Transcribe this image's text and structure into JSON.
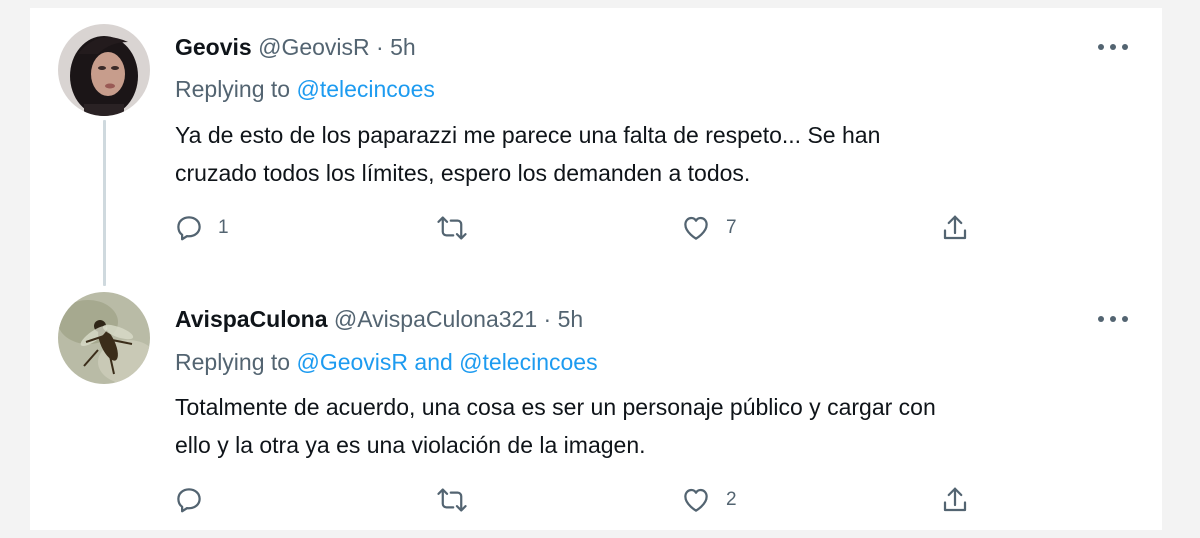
{
  "colors": {
    "link": "#1d9bf0",
    "secondary": "#536471",
    "text": "#0f1419",
    "thread_line": "#cfd9de"
  },
  "tweets": [
    {
      "avatar": "woman-portrait-avatar",
      "name": "Geovis",
      "handle": "@GeovisR",
      "separator": "·",
      "time": "5h",
      "replying_prefix": "Replying to",
      "replying_to": "@telecincoes",
      "text_line1": "Ya de esto de los paparazzi me parece una falta de respeto... Se han",
      "text_line2": "cruzado todos los límites, espero los demanden a todos.",
      "reply_count": "1",
      "retweet_count": "",
      "like_count": "7"
    },
    {
      "avatar": "wasp-avatar",
      "name": "AvispaCulona",
      "handle": "@AvispaCulona321",
      "separator": "·",
      "time": "5h",
      "replying_prefix": "Replying to",
      "replying_to": "@GeovisR and @telecincoes",
      "text_line1": "Totalmente de acuerdo, una cosa es ser un personaje público y cargar con",
      "text_line2": "ello y la otra ya es una violación de la imagen.",
      "reply_count": "",
      "retweet_count": "",
      "like_count": "2"
    }
  ],
  "icons": {
    "reply": "speech-bubble-icon",
    "retweet": "retweet-arrows-icon",
    "like": "heart-icon",
    "share": "share-upload-icon",
    "more": "more-dots-icon"
  }
}
